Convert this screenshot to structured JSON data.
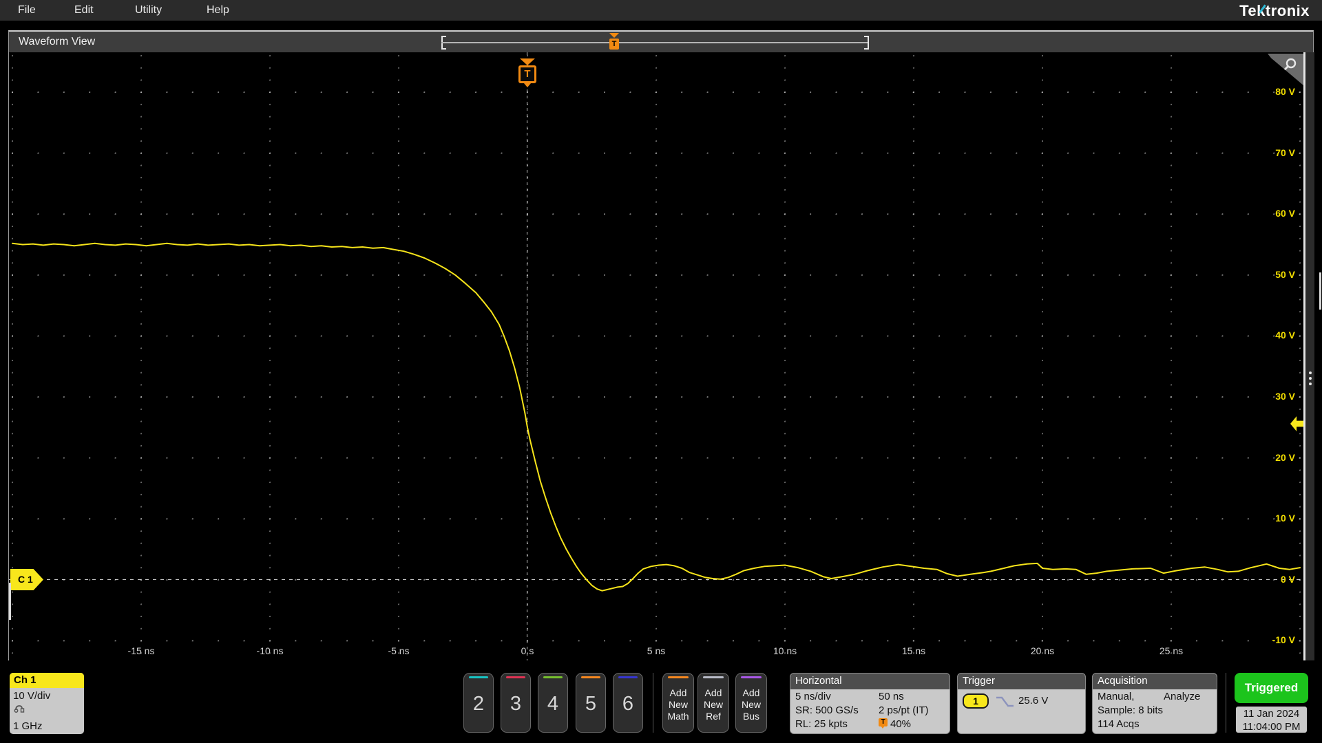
{
  "menu": {
    "items": [
      "File",
      "Edit",
      "Utility",
      "Help"
    ],
    "logo": "Tektronix"
  },
  "view": {
    "title": "Waveform View"
  },
  "markers": {
    "trigger_letter": "T",
    "channel_badge": "C 1"
  },
  "plot": {
    "voltage_labels": [
      {
        "v": 80,
        "label": "80 V"
      },
      {
        "v": 70,
        "label": "70 V"
      },
      {
        "v": 60,
        "label": "60 V"
      },
      {
        "v": 50,
        "label": "50 V"
      },
      {
        "v": 40,
        "label": "40 V"
      },
      {
        "v": 30,
        "label": "30 V"
      },
      {
        "v": 20,
        "label": "20 V"
      },
      {
        "v": 10,
        "label": "10 V"
      },
      {
        "v": 0,
        "label": "0 V"
      },
      {
        "v": -10,
        "label": "-10 V"
      }
    ],
    "time_labels": [
      {
        "t": -15,
        "label": "-15 ns"
      },
      {
        "t": -10,
        "label": "-10 ns"
      },
      {
        "t": -5,
        "label": "-5 ns"
      },
      {
        "t": 0,
        "label": "0 s"
      },
      {
        "t": 5,
        "label": "5 ns"
      },
      {
        "t": 10,
        "label": "10 ns"
      },
      {
        "t": 15,
        "label": "15 ns"
      },
      {
        "t": 20,
        "label": "20 ns"
      },
      {
        "t": 25,
        "label": "25 ns"
      }
    ]
  },
  "waveform": {
    "color": "#f6e41a",
    "points": [
      [
        -20,
        55.2
      ],
      [
        -19.6,
        55.0
      ],
      [
        -19.2,
        55.1
      ],
      [
        -18.8,
        54.9
      ],
      [
        -18.4,
        55.1
      ],
      [
        -18,
        55.0
      ],
      [
        -17.6,
        54.8
      ],
      [
        -17.2,
        55.0
      ],
      [
        -16.8,
        55.2
      ],
      [
        -16.4,
        55.0
      ],
      [
        -16,
        54.9
      ],
      [
        -15.6,
        55.1
      ],
      [
        -15.2,
        55.0
      ],
      [
        -14.8,
        54.8
      ],
      [
        -14.4,
        55.0
      ],
      [
        -14,
        55.2
      ],
      [
        -13.6,
        55.0
      ],
      [
        -13.2,
        54.9
      ],
      [
        -12.8,
        55.1
      ],
      [
        -12.4,
        54.9
      ],
      [
        -12,
        55.0
      ],
      [
        -11.6,
        55.1
      ],
      [
        -11.2,
        54.9
      ],
      [
        -10.8,
        55.0
      ],
      [
        -10.4,
        54.8
      ],
      [
        -10,
        54.9
      ],
      [
        -9.6,
        55.0
      ],
      [
        -9.2,
        54.8
      ],
      [
        -8.8,
        54.9
      ],
      [
        -8.4,
        54.7
      ],
      [
        -8,
        54.8
      ],
      [
        -7.6,
        54.6
      ],
      [
        -7.2,
        54.7
      ],
      [
        -6.8,
        54.5
      ],
      [
        -6.4,
        54.6
      ],
      [
        -6,
        54.4
      ],
      [
        -5.6,
        54.5
      ],
      [
        -5.2,
        54.2
      ],
      [
        -4.8,
        53.9
      ],
      [
        -4.4,
        53.4
      ],
      [
        -4,
        52.8
      ],
      [
        -3.6,
        52.0
      ],
      [
        -3.2,
        51.1
      ],
      [
        -2.8,
        50.0
      ],
      [
        -2.4,
        48.6
      ],
      [
        -2,
        47.1
      ],
      [
        -1.7,
        45.6
      ],
      [
        -1.4,
        44.0
      ],
      [
        -1.1,
        41.9
      ],
      [
        -0.9,
        39.9
      ],
      [
        -0.7,
        37.6
      ],
      [
        -0.5,
        34.8
      ],
      [
        -0.3,
        31.5
      ],
      [
        -0.1,
        27.4
      ],
      [
        0,
        25.0
      ],
      [
        0.1,
        23.0
      ],
      [
        0.3,
        19.5
      ],
      [
        0.5,
        16.2
      ],
      [
        0.7,
        13.5
      ],
      [
        0.9,
        11.0
      ],
      [
        1.1,
        8.8
      ],
      [
        1.3,
        6.8
      ],
      [
        1.5,
        5.1
      ],
      [
        1.7,
        3.6
      ],
      [
        1.9,
        2.2
      ],
      [
        2.1,
        1.0
      ],
      [
        2.3,
        0.0
      ],
      [
        2.5,
        -0.9
      ],
      [
        2.7,
        -1.5
      ],
      [
        2.9,
        -1.8
      ],
      [
        3.1,
        -1.6
      ],
      [
        3.3,
        -1.4
      ],
      [
        3.5,
        -1.2
      ],
      [
        3.7,
        -1.1
      ],
      [
        3.9,
        -0.6
      ],
      [
        4.1,
        0.2
      ],
      [
        4.3,
        1.1
      ],
      [
        4.5,
        1.8
      ],
      [
        4.8,
        2.2
      ],
      [
        5.1,
        2.4
      ],
      [
        5.4,
        2.5
      ],
      [
        5.7,
        2.3
      ],
      [
        6,
        1.9
      ],
      [
        6.3,
        1.2
      ],
      [
        6.6,
        0.8
      ],
      [
        6.9,
        0.4
      ],
      [
        7.2,
        0.2
      ],
      [
        7.5,
        0.1
      ],
      [
        7.8,
        0.4
      ],
      [
        8.1,
        0.9
      ],
      [
        8.4,
        1.5
      ],
      [
        8.8,
        1.9
      ],
      [
        9.2,
        2.2
      ],
      [
        9.6,
        2.3
      ],
      [
        10,
        2.4
      ],
      [
        10.5,
        2.0
      ],
      [
        11,
        1.4
      ],
      [
        11.5,
        0.5
      ],
      [
        11.8,
        0.2
      ],
      [
        12.2,
        0.5
      ],
      [
        12.7,
        0.9
      ],
      [
        13.2,
        1.5
      ],
      [
        13.8,
        2.1
      ],
      [
        14.4,
        2.5
      ],
      [
        14.9,
        2.2
      ],
      [
        15.4,
        1.9
      ],
      [
        15.9,
        1.7
      ],
      [
        16.3,
        1.0
      ],
      [
        16.7,
        0.6
      ],
      [
        17.2,
        0.9
      ],
      [
        17.7,
        1.2
      ],
      [
        18,
        1.4
      ],
      [
        18.4,
        1.8
      ],
      [
        18.9,
        2.3
      ],
      [
        19.4,
        2.6
      ],
      [
        19.8,
        2.7
      ],
      [
        20,
        1.9
      ],
      [
        20.4,
        1.7
      ],
      [
        20.9,
        1.8
      ],
      [
        21.3,
        1.7
      ],
      [
        21.7,
        0.9
      ],
      [
        22.1,
        1.1
      ],
      [
        22.5,
        1.4
      ],
      [
        23,
        1.6
      ],
      [
        23.5,
        1.8
      ],
      [
        24.2,
        1.9
      ],
      [
        24.7,
        1.1
      ],
      [
        25.2,
        1.5
      ],
      [
        25.8,
        1.9
      ],
      [
        26.3,
        2.1
      ],
      [
        26.8,
        1.7
      ],
      [
        27.2,
        1.3
      ],
      [
        27.6,
        1.4
      ],
      [
        28.1,
        2.0
      ],
      [
        28.7,
        2.6
      ],
      [
        29.2,
        1.9
      ],
      [
        29.6,
        1.7
      ],
      [
        30,
        2.0
      ]
    ]
  },
  "bottom": {
    "ch1": {
      "title": "Ch 1",
      "scale": "10 V/div",
      "bandwidth": "1 GHz"
    },
    "channels": [
      {
        "label": "2",
        "color": "#17c3c3"
      },
      {
        "label": "3",
        "color": "#e03354"
      },
      {
        "label": "4",
        "color": "#77c02e"
      },
      {
        "label": "5",
        "color": "#f6881f"
      },
      {
        "label": "6",
        "color": "#3636d2"
      }
    ],
    "add_buttons": [
      {
        "line1": "Add",
        "line2": "New",
        "line3": "Math",
        "color": "#f6881f"
      },
      {
        "line1": "Add",
        "line2": "New",
        "line3": "Ref",
        "color": "#b9bcc8"
      },
      {
        "line1": "Add",
        "line2": "New",
        "line3": "Bus",
        "color": "#a958e8"
      }
    ],
    "horizontal": {
      "title": "Horizontal",
      "r1c1": "5 ns/div",
      "r1c2": "50 ns",
      "r2c1": "SR: 500 GS/s",
      "r2c2": "2 ps/pt (IT)",
      "r3c1": "RL: 25 kpts",
      "r3c2": "40%",
      "t_glyph": "T"
    },
    "trigger": {
      "title": "Trigger",
      "source": "1",
      "level": "25.6 V"
    },
    "acquisition": {
      "title": "Acquisition",
      "mode": "Manual,",
      "analyze": "Analyze",
      "sample": "Sample: 8 bits",
      "acqs": "114 Acqs"
    },
    "status": {
      "label": "Triggered",
      "date": "11 Jan 2024",
      "time": "11:04:00 PM"
    }
  }
}
